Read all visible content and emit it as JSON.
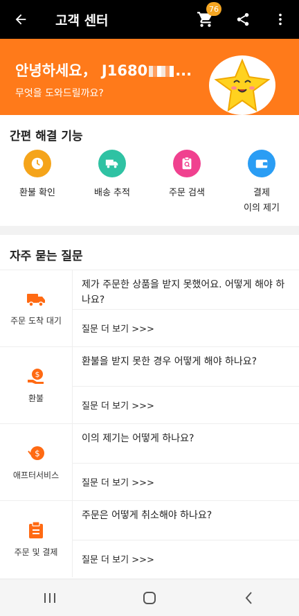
{
  "header": {
    "title": "고객 센터",
    "cart_count": "76"
  },
  "banner": {
    "greeting_prefix": "안녕하세요，",
    "user_partial": "J1680",
    "ellipsis": "...",
    "subtitle": "무엇을 도와드릴까요?"
  },
  "quick": {
    "title": "간편 해결 기능",
    "items": [
      {
        "label": "환불 확인",
        "color": "#f5a41a",
        "icon": "clock-icon"
      },
      {
        "label": "배송 추적",
        "color": "#2fc2a3",
        "icon": "truck-icon"
      },
      {
        "label": "주문 검색",
        "color": "#f0418f",
        "icon": "clipboard-search-icon"
      },
      {
        "label": "결제\n이의 제기",
        "color": "#2a9df4",
        "icon": "wallet-icon"
      }
    ]
  },
  "faq": {
    "title": "자주 묻는 질문",
    "more_label": "질문 더 보기 >>>",
    "rows": [
      {
        "category": "주문 도착 대기",
        "icon": "truck-icon",
        "question": "제가 주문한 상품을 받지 못했어요. 어떻게 해야 하나요?"
      },
      {
        "category": "환불",
        "icon": "refund-icon",
        "question": "환불을 받지 못한 경우 어떻게 해야 하나요?"
      },
      {
        "category": "애프터서비스",
        "icon": "after-service-icon",
        "question": "이의 제기는 어떻게 하나요?"
      },
      {
        "category": "주문 및 결제",
        "icon": "order-clipboard-icon",
        "question": "주문은 어떻게 취소해야 하나요?"
      }
    ]
  },
  "colors": {
    "accent": "#ff7a1a",
    "topbar": "#000000",
    "badge": "#f5a623"
  }
}
